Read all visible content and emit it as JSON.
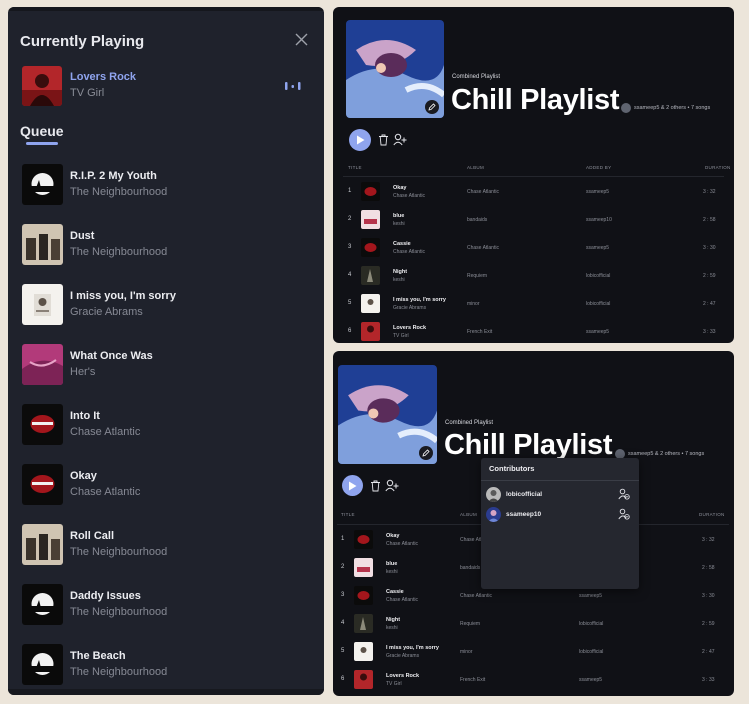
{
  "queue_panel": {
    "title": "Currently Playing",
    "now_playing": {
      "title": "Lovers Rock",
      "artist": "TV Girl"
    },
    "queue_heading": "Queue",
    "items": [
      {
        "title": "R.I.P. 2 My Youth",
        "artist": "The Neighbourhood"
      },
      {
        "title": "Dust",
        "artist": "The Neighbourhood"
      },
      {
        "title": "I miss you, I'm sorry",
        "artist": "Gracie Abrams"
      },
      {
        "title": "What Once Was",
        "artist": "Her's"
      },
      {
        "title": "Into It",
        "artist": "Chase Atlantic"
      },
      {
        "title": "Okay",
        "artist": "Chase Atlantic"
      },
      {
        "title": "Roll Call",
        "artist": "The Neighbourhood"
      },
      {
        "title": "Daddy Issues",
        "artist": "The Neighbourhood"
      },
      {
        "title": "The Beach",
        "artist": "The Neighbourhood"
      }
    ]
  },
  "playlist": {
    "type": "Combined Playlist",
    "name": "Chill Playlist",
    "meta": "ssameep5 & 2 others • 7 songs",
    "meta_alt": "ssameep5 & 2 others • 7 songs",
    "columns": {
      "title": "TITLE",
      "album": "ALBUM",
      "added_by": "ADDED BY",
      "duration": "DURATION"
    },
    "tracks": [
      {
        "num": "1",
        "title": "Okay",
        "artist": "Chase Atlantic",
        "album": "Chase Atlantic",
        "added_by": "ssameep5",
        "duration": "3 : 32"
      },
      {
        "num": "2",
        "title": "blue",
        "artist": "keshi",
        "album": "bandaids",
        "added_by": "ssameep10",
        "duration": "2 : 58"
      },
      {
        "num": "3",
        "title": "Cassie",
        "artist": "Chase Atlantic",
        "album": "Chase Atlantic",
        "added_by": "ssameep5",
        "duration": "3 : 30"
      },
      {
        "num": "4",
        "title": "Night",
        "artist": "keshi",
        "album": "Requiem",
        "added_by": "lobicofficial",
        "duration": "2 : 59"
      },
      {
        "num": "5",
        "title": "I miss you, I'm sorry",
        "artist": "Gracie Abrams",
        "album": "minor",
        "added_by": "lobicofficial",
        "duration": "2 : 47"
      },
      {
        "num": "6",
        "title": "Lovers Rock",
        "artist": "TV Girl",
        "album": "French Exit",
        "added_by": "ssameep5",
        "duration": "3 : 33"
      }
    ]
  },
  "contributors": {
    "title": "Contributors",
    "people": [
      {
        "name": "lobicofficial"
      },
      {
        "name": "ssameep10"
      }
    ]
  },
  "colors": {
    "accent": "#8fa4ee",
    "panel": "#1f222c",
    "playlist_bg": "#101116",
    "page_bg": "#ece5da"
  }
}
